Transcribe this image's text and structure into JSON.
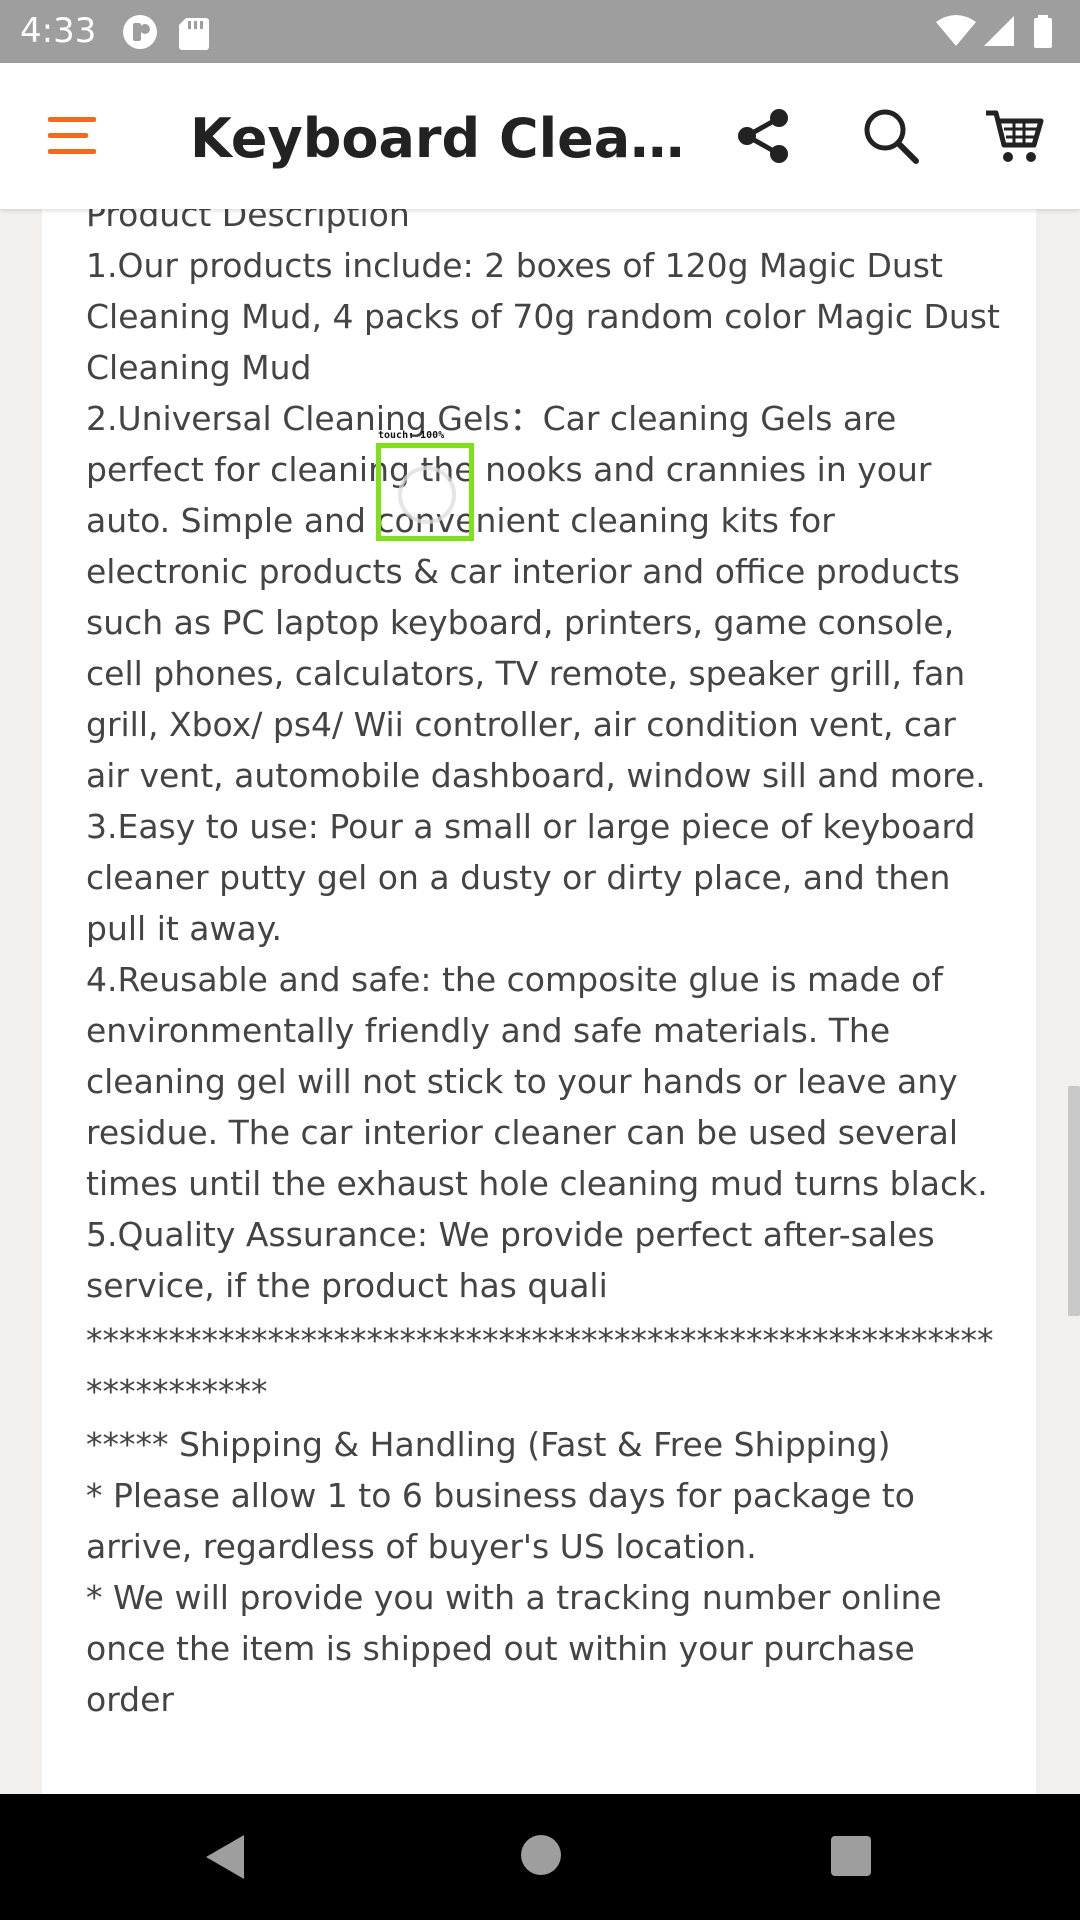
{
  "status_bar": {
    "time": "4:33",
    "left_icons": [
      "app-notification-icon",
      "sd-card-icon"
    ],
    "right_icons": [
      "wifi-icon",
      "signal-icon",
      "battery-icon"
    ]
  },
  "app_bar": {
    "title": "Keyboard Cleane...",
    "menu_icon": "hamburger-menu-icon",
    "share_icon": "share-icon",
    "search_icon": "search-icon",
    "cart_icon": "cart-icon",
    "accent_color": "#f26b1d"
  },
  "touch_indicator": {
    "label": "touch: 100%"
  },
  "description": {
    "heading": "Product Description",
    "items": [
      "1.Our products include: 2 boxes of 120g Magic Dust Cleaning Mud, 4 packs of 70g random color Magic Dust Cleaning Mud",
      "2.Universal Cleaning Gels：Car cleaning Gels are perfect for cleaning the nooks and crannies in your auto. Simple and convenient cleaning kits for electronic products & car interior and office products such as PC laptop keyboard, printers, game console, cell phones, calculators, TV remote, speaker grill, fan grill, Xbox/ ps4/ Wii controller, air condition vent, car air vent, automobile dashboard, window sill and more.",
      "3.Easy to use: Pour a small or large piece of keyboard cleaner putty gel on a dusty or dirty place, and then pull it away.",
      "4.Reusable and safe: the composite glue is made of environmentally friendly and safe materials. The cleaning gel will not stick to your hands or leave any residue. The car interior cleaner can be used several times until the exhaust hole cleaning mud turns black.",
      "5.Quality Assurance: We provide perfect after-sales service, if the product has quali"
    ],
    "separator": "******************************************************************",
    "shipping_heading": "***** Shipping & Handling (Fast & Free Shipping)",
    "shipping_items": [
      "* Please allow 1 to 6 business days for package to arrive, regardless of buyer's US location.",
      "* We will provide you with a tracking number online once the item is shipped out within your purchase order"
    ]
  }
}
